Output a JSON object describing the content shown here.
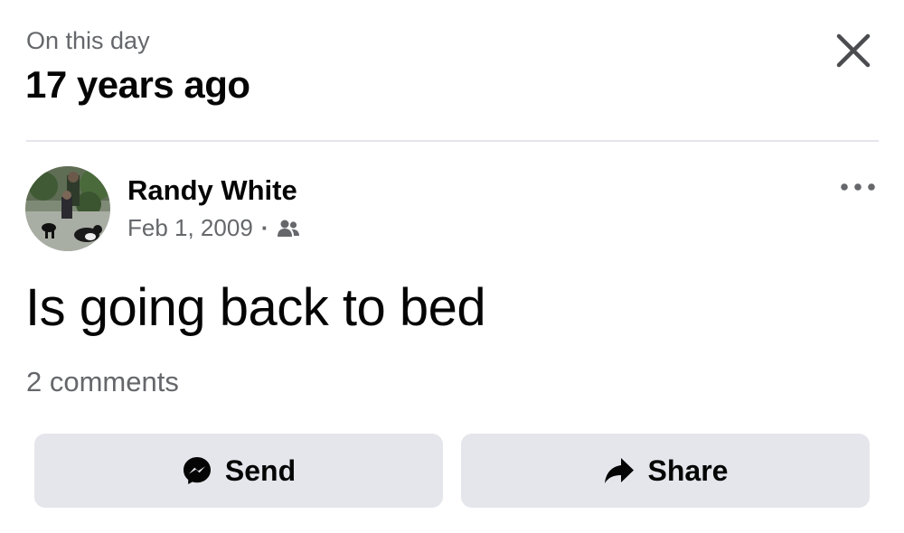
{
  "header": {
    "overline": "On this day",
    "title": "17 years ago",
    "close_icon": "close-icon"
  },
  "post": {
    "author": "Randy White",
    "date": "Feb 1, 2009",
    "separator": "·",
    "audience_icon": "friends-icon",
    "more_icon": "more-horizontal-icon",
    "text": "Is going back to bed",
    "comments": "2 comments"
  },
  "actions": {
    "send_label": "Send",
    "send_icon": "messenger-icon",
    "share_label": "Share",
    "share_icon": "share-arrow-icon"
  },
  "colors": {
    "background": "#ffffff",
    "text_primary": "#050505",
    "text_secondary": "#65676b",
    "button_bg": "#e4e6eb",
    "divider": "#e4e6eb"
  }
}
